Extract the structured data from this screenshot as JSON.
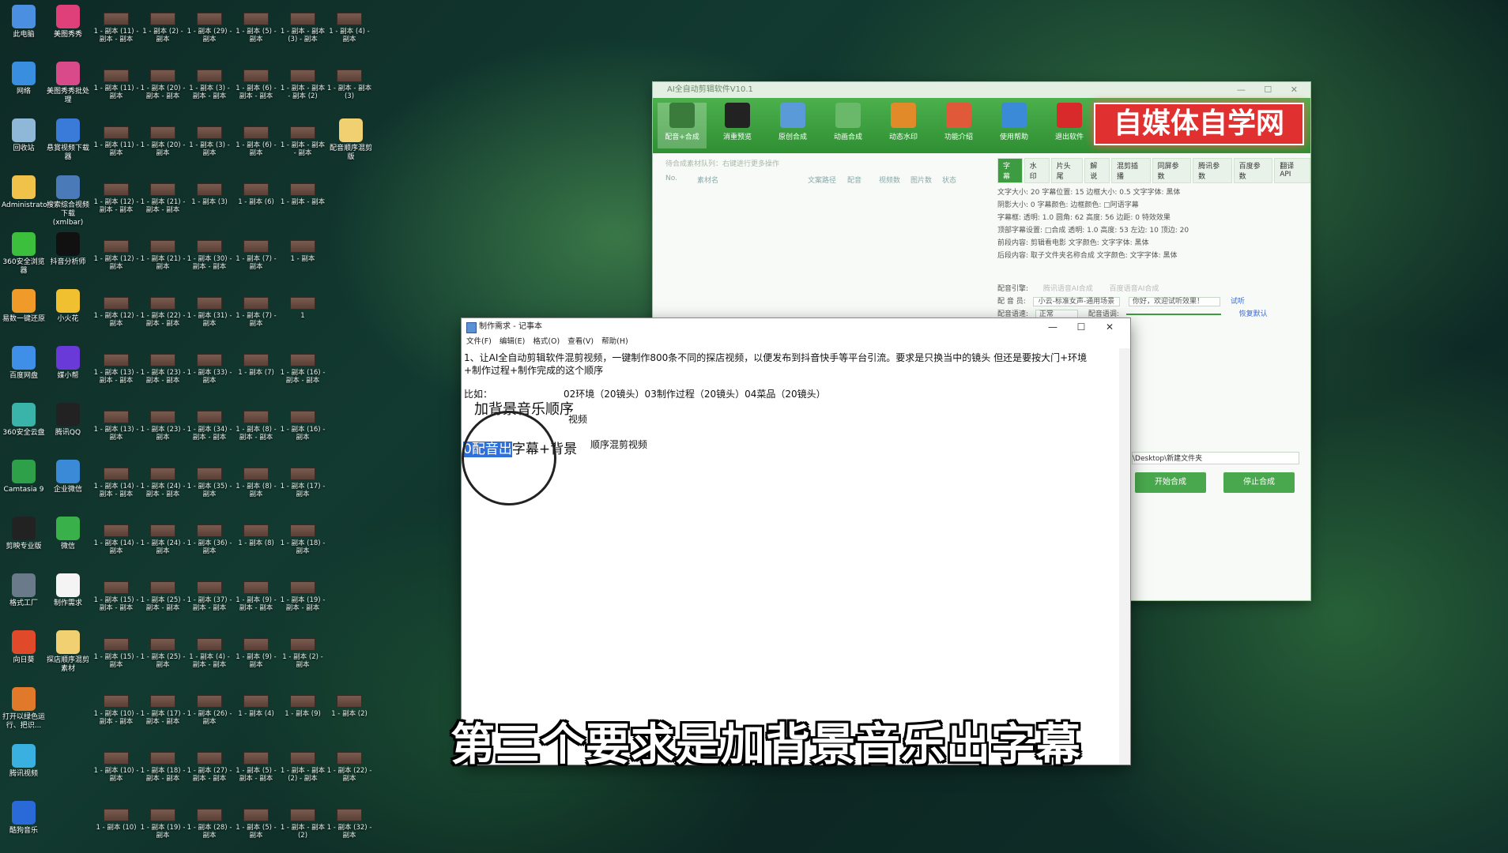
{
  "desktop": {
    "left_icons": [
      {
        "label": "此电脑",
        "color": "#4b8fe0"
      },
      {
        "label": "网络",
        "color": "#3a8ee0"
      },
      {
        "label": "回收站",
        "color": "#8fb7d8"
      },
      {
        "label": "Administrator",
        "color": "#f0c24a"
      },
      {
        "label": "360安全浏览器",
        "color": "#3cbf3c"
      },
      {
        "label": "易数一键还原",
        "color": "#f09a2a"
      },
      {
        "label": "百度网盘",
        "color": "#3f8fe8"
      },
      {
        "label": "360安全云盘",
        "color": "#3ab3a8"
      },
      {
        "label": "Camtasia 9",
        "color": "#2ea04a"
      },
      {
        "label": "剪映专业版",
        "color": "#222222"
      },
      {
        "label": "格式工厂",
        "color": "#6a7a8a"
      },
      {
        "label": "向日葵",
        "color": "#e04a2a"
      },
      {
        "label": "打开以绿色运行、把识...",
        "color": "#e07a2a"
      },
      {
        "label": "腾讯视频",
        "color": "#3ab0e0"
      },
      {
        "label": "酷狗音乐",
        "color": "#2a6ad8"
      }
    ],
    "second_icons": [
      {
        "label": "美图秀秀",
        "color": "#e0407a"
      },
      {
        "label": "美图秀秀批处理",
        "color": "#d84a8a"
      },
      {
        "label": "悬賞视频下载器",
        "color": "#3a7ad8"
      },
      {
        "label": "搜索综合视频下载(xmlbar)",
        "color": "#4a7ab8"
      },
      {
        "label": "抖音分析师",
        "color": "#111111"
      },
      {
        "label": "小火花",
        "color": "#f0c030"
      },
      {
        "label": "媒小帮",
        "color": "#6a3ad8"
      },
      {
        "label": "腾讯QQ",
        "color": "#222222"
      },
      {
        "label": "企业微信",
        "color": "#3a8ad8"
      },
      {
        "label": "微信",
        "color": "#3ab04a"
      },
      {
        "label": "制作需求",
        "color": "#f4f4f4"
      },
      {
        "label": "探店顺序混剪素材",
        "color": "#f0d070"
      },
      {
        "label": "配音顺序混剪版",
        "color": "#f0d070"
      }
    ],
    "file_rows": [
      [
        "1 - 副本 (11) - 副本 - 副本",
        "1 - 副本 (2) - 副本",
        "1 - 副本 (29) - 副本",
        "1 - 副本 (5) - 副本",
        "1 - 副本 - 副本 (3) - 副本",
        "1 - 副本 (4) - 副本"
      ],
      [
        "1 - 副本 (11) - 副本",
        "1 - 副本 (20) - 副本 - 副本",
        "1 - 副本 (3) - 副本 - 副本",
        "1 - 副本 (6) - 副本 - 副本",
        "1 - 副本 - 副本 - 副本 (2)",
        "1 - 副本 - 副本 (3)"
      ],
      [
        "1 - 副本 (11) - 副本",
        "1 - 副本 (20) - 副本",
        "1 - 副本 (3) - 副本",
        "1 - 副本 (6) - 副本",
        "1 - 副本 - 副本 - 副本",
        ""
      ],
      [
        "1 - 副本 (12) - 副本 - 副本",
        "1 - 副本 (21) - 副本 - 副本",
        "1 - 副本 (3)",
        "1 - 副本 (6)",
        "1 - 副本 - 副本",
        ""
      ],
      [
        "1 - 副本 (12) - 副本",
        "1 - 副本 (21) - 副本",
        "1 - 副本 (30) - 副本 - 副本",
        "1 - 副本 (7) - 副本",
        "1 - 副本",
        ""
      ],
      [
        "1 - 副本 (12) - 副本",
        "1 - 副本 (22) - 副本 - 副本",
        "1 - 副本 (31) - 副本",
        "1 - 副本 (7) - 副本",
        "1",
        ""
      ],
      [
        "1 - 副本 (13) - 副本 - 副本",
        "1 - 副本 (23) - 副本 - 副本",
        "1 - 副本 (33) - 副本",
        "1 - 副本 (7)",
        "1 - 副本 (16) - 副本 - 副本",
        ""
      ],
      [
        "1 - 副本 (13) - 副本",
        "1 - 副本 (23) - 副本",
        "1 - 副本 (34) - 副本 - 副本",
        "1 - 副本 (8) - 副本 - 副本",
        "1 - 副本 (16) - 副本",
        ""
      ],
      [
        "1 - 副本 (14) - 副本 - 副本",
        "1 - 副本 (24) - 副本 - 副本",
        "1 - 副本 (35) - 副本",
        "1 - 副本 (8) - 副本",
        "1 - 副本 (17) - 副本",
        ""
      ],
      [
        "1 - 副本 (14) - 副本",
        "1 - 副本 (24) - 副本",
        "1 - 副本 (36) - 副本",
        "1 - 副本 (8)",
        "1 - 副本 (18) - 副本",
        ""
      ],
      [
        "1 - 副本 (15) - 副本 - 副本",
        "1 - 副本 (25) - 副本 - 副本",
        "1 - 副本 (37) - 副本 - 副本",
        "1 - 副本 (9) - 副本 - 副本",
        "1 - 副本 (19) - 副本 - 副本",
        ""
      ],
      [
        "1 - 副本 (15) - 副本",
        "1 - 副本 (25) - 副本",
        "1 - 副本 (4) - 副本 - 副本",
        "1 - 副本 (9) - 副本",
        "1 - 副本 (2) - 副本",
        ""
      ],
      [
        "1 - 副本 (10) - 副本 - 副本",
        "1 - 副本 (17) - 副本 - 副本",
        "1 - 副本 (26) - 副本",
        "1 - 副本 (4)",
        "1 - 副本 (9)",
        "1 - 副本 (2)"
      ],
      [
        "1 - 副本 (10) - 副本",
        "1 - 副本 (18) - 副本 - 副本",
        "1 - 副本 (27) - 副本 - 副本",
        "1 - 副本 (5) - 副本 - 副本",
        "1 - 副本 - 副本 (2) - 副本",
        "1 - 副本 (22) - 副本"
      ],
      [
        "1 - 副本 (10)",
        "1 - 副本 (19) - 副本",
        "1 - 副本 (28) - 副本",
        "1 - 副本 (5) - 副本",
        "1 - 副本 - 副本 (2)",
        "1 - 副本 (32) - 副本"
      ]
    ]
  },
  "app": {
    "title": "AI全自动剪辑软件V10.1",
    "toolbar": [
      {
        "label": "配音+合成",
        "color": "#3a7a3a"
      },
      {
        "label": "消重预览",
        "color": "#222222"
      },
      {
        "label": "原创合成",
        "color": "#5a9ad8"
      },
      {
        "label": "动画合成",
        "color": "#6ab86a"
      },
      {
        "label": "动态水印",
        "color": "#e08a2a"
      },
      {
        "label": "功能介绍",
        "color": "#e05a3a"
      },
      {
        "label": "使用帮助",
        "color": "#3a8ad8"
      },
      {
        "label": "退出软件",
        "color": "#d82a2a"
      }
    ],
    "brand": "自媒体自学网",
    "left_hint": "待合成素材队列：右键进行更多操作",
    "columns": [
      "No.",
      "素材名",
      "文案路径",
      "配音",
      "视频数",
      "图片数",
      "状态"
    ],
    "tabs": [
      "字幕",
      "水印",
      "片头尾",
      "解说",
      "混剪插播",
      "同屏参数",
      "腾讯参数",
      "百度参数",
      "翻译API"
    ],
    "fields": [
      "文字大小: 20  字幕位置: 15  边框大小: 0.5  文字字体: 黑体",
      "阴影大小: 0  字幕颜色:  边框颜色:  □阿语字幕",
      "字幕框:  透明: 1.0  圆角: 62  高度: 56  边距: 0  特效效果",
      "顶部字幕设置: □合成  透明: 1.0  高度: 53  左边: 10  顶边: 20",
      "前段内容: 剪辑看电影  文字颜色:  文字字体: 黑体",
      "后段内容: 取子文件夹名称合成  文字颜色:  文字字体: 黑体"
    ],
    "voice": {
      "engine_label": "配音引擎:",
      "engine_a": "腾讯语音AI合成",
      "engine_b": "百度语音AI合成",
      "voice_label": "配 音 员:",
      "voice_value": "小云-标准女声-通用场景",
      "sample_text": "你好，欢迎试听效果！",
      "try_label": "试听",
      "speed_label": "配音语速:",
      "speed_value": "正常",
      "pitch_label": "配音语调:",
      "reset_label": "恢复默认"
    },
    "output_path": "\\Desktop\\新建文件夹",
    "start_label": "开始合成",
    "stop_label": "停止合成"
  },
  "notepad": {
    "title": "制作需求 - 记事本",
    "menu": [
      "文件(F)",
      "编辑(E)",
      "格式(O)",
      "查看(V)",
      "帮助(H)"
    ],
    "line1": "1、让AI全自动剪辑软件混剪视频，一键制作800条不同的探店视频，以便发布到抖音快手等平台引流。要求是只换当中的镜头  但还是要按大门+环境",
    "line2": "+制作过程+制作完成的这个顺序",
    "line3a": "比如：",
    "line3b": "02环境（20镜头）03制作过程（20镜头）04菜品（20镜头）",
    "line4_suffix": "视频",
    "mag_title": "加背景音乐顺序",
    "mag_highlight": "0配音出",
    "mag_rest": "字幕+背景",
    "line5_suffix": "顺序混剪视频"
  },
  "subtitle": "第三个要求是加背景音乐出字幕"
}
